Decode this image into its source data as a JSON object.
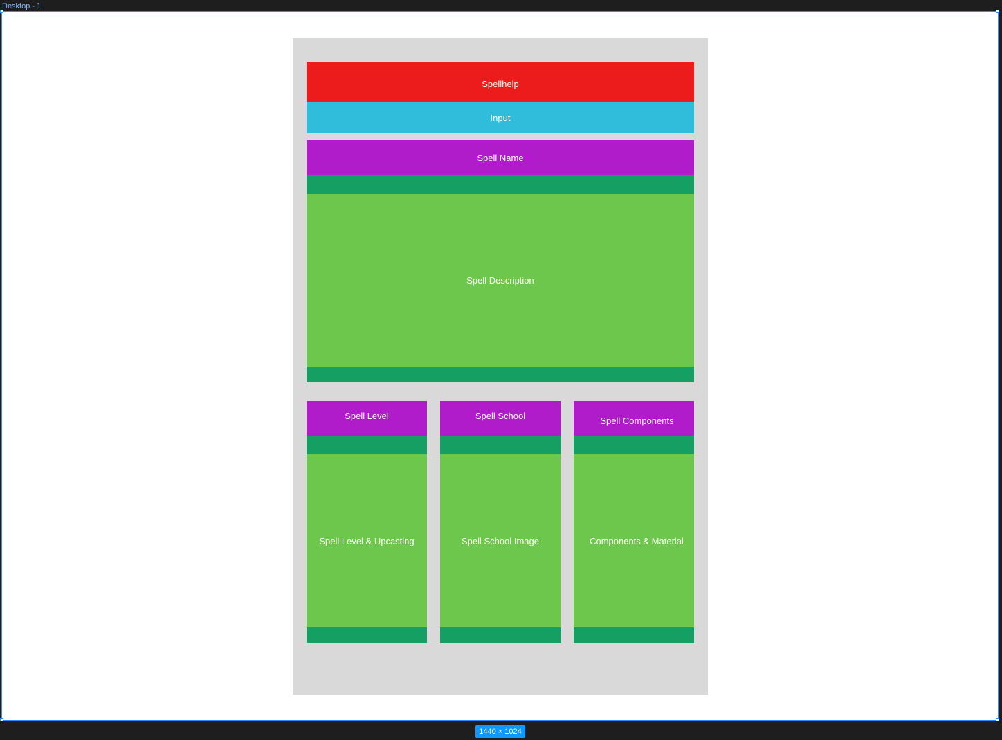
{
  "canvas": {
    "frame_label": "Desktop - 1",
    "size_badge": "1440 × 1024"
  },
  "wireframe": {
    "header": "Spellhelp",
    "input": "Input",
    "spell_name": "Spell Name",
    "spell_description": "Spell Description",
    "columns": [
      {
        "title": "Spell Level",
        "body": "Spell Level & Upcasting"
      },
      {
        "title": "Spell School",
        "body": "Spell School Image"
      },
      {
        "title": "Spell Components",
        "body": "Components & Material"
      }
    ]
  },
  "colors": {
    "header": "#ed1c1c",
    "input": "#2fbddb",
    "title_bar": "#b01cc9",
    "strip": "#169f63",
    "body": "#6cc74c",
    "panel": "#d9d9d9"
  }
}
